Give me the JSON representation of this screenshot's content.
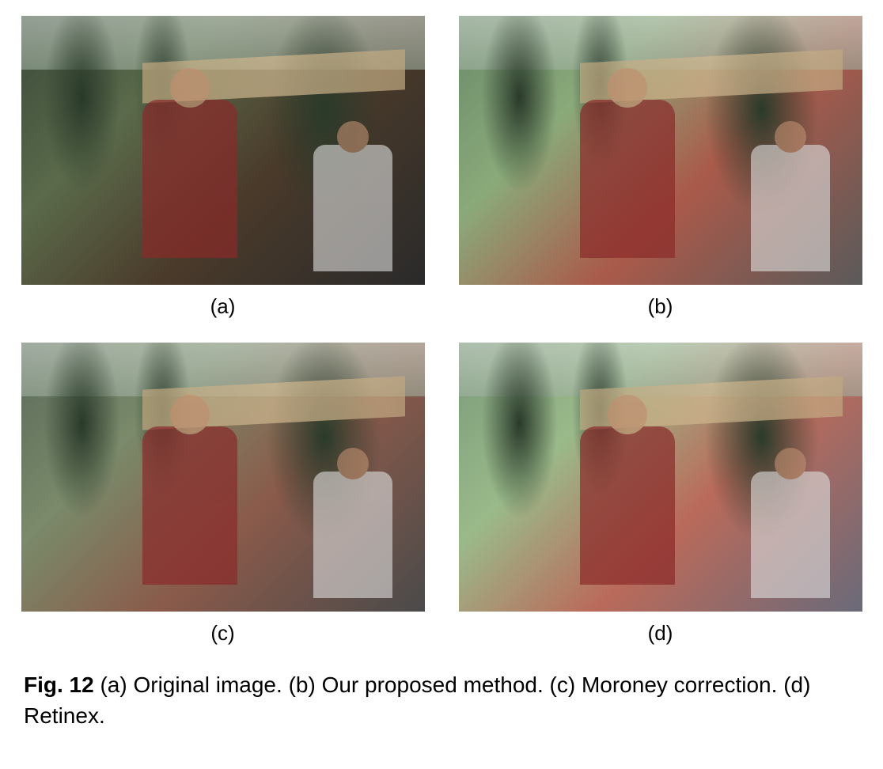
{
  "figure": {
    "label": "Fig. 12",
    "caption_parts": {
      "a": "(a) Original image.",
      "b": "(b) Our proposed method.",
      "c": "(c) Moroney correction.",
      "d": "(d) Retinex."
    },
    "sublabels": {
      "a": "(a)",
      "b": "(b)",
      "c": "(c)",
      "d": "(d)"
    }
  }
}
